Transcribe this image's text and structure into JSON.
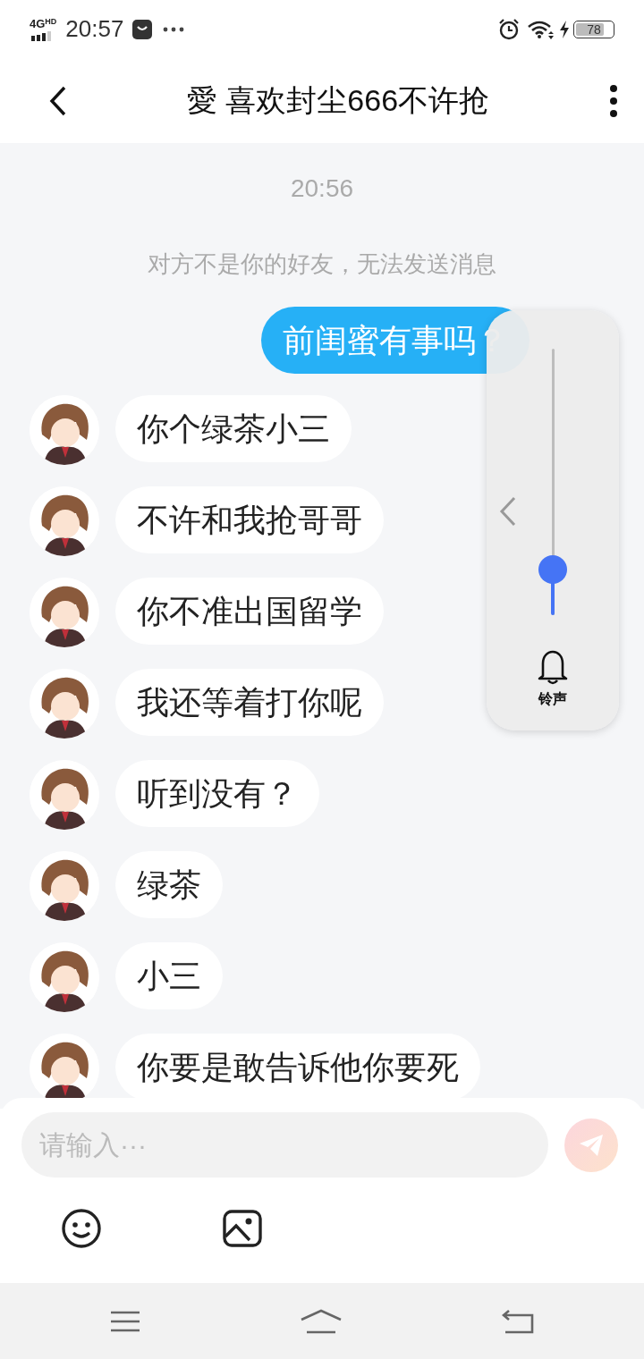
{
  "status_bar": {
    "network": "4G",
    "network_badge": "HD",
    "time": "20:57",
    "battery": "78",
    "charging": true
  },
  "header": {
    "title": "愛 喜欢封尘666不许抢"
  },
  "chat": {
    "timestamp": "20:56",
    "notice": "对方不是你的好友，无法发送消息",
    "messages": [
      {
        "kind": "sent",
        "text": "前闺蜜有事吗？"
      },
      {
        "kind": "received",
        "text": "你个绿茶小三"
      },
      {
        "kind": "received",
        "text": "不许和我抢哥哥"
      },
      {
        "kind": "received",
        "text": "你不准出国留学"
      },
      {
        "kind": "received",
        "text": "我还等着打你呢"
      },
      {
        "kind": "received",
        "text": "听到没有？"
      },
      {
        "kind": "received",
        "text": "绿茶"
      },
      {
        "kind": "received",
        "text": "小三"
      },
      {
        "kind": "received",
        "text": "你要是敢告诉他你要死"
      }
    ]
  },
  "volume_panel": {
    "level": 0.17,
    "label": "铃声"
  },
  "composer": {
    "placeholder": "请输入···"
  }
}
